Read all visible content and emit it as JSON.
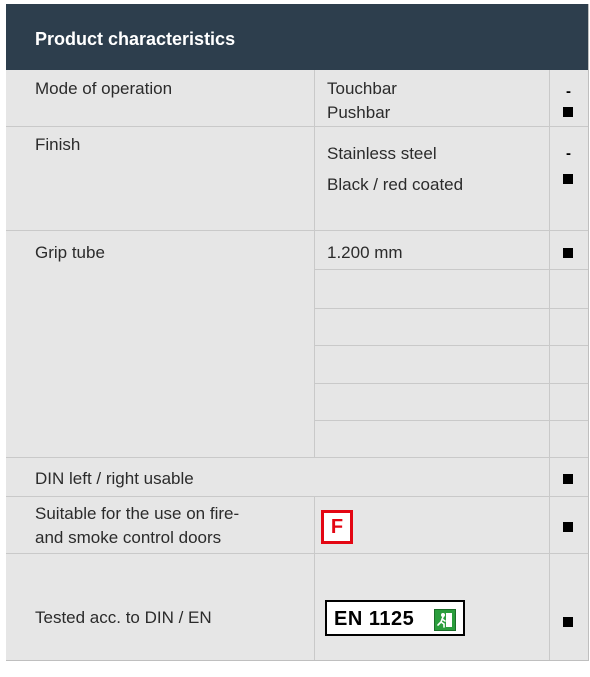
{
  "header": {
    "title": "Product characteristics"
  },
  "rows": {
    "mode": {
      "label": "Mode of operation",
      "value1": "Touchbar",
      "value2": "Pushbar",
      "mark1": "-",
      "mark2": "■"
    },
    "finish": {
      "label": "Finish",
      "value1": "Stainless steel",
      "value2": "Black / red coated",
      "mark1": "-",
      "mark2": "■"
    },
    "grip": {
      "label": "Grip tube",
      "value": "1.200 mm",
      "mark": "■"
    },
    "din": {
      "label": "DIN left / right usable",
      "mark": "■"
    },
    "fire": {
      "label_line1": "Suitable for the use on fire-",
      "label_line2": "and smoke control doors",
      "badge": "F",
      "mark": "■"
    },
    "tested": {
      "label": "Tested acc. to DIN / EN",
      "badge": "EN 1125",
      "mark": "■"
    }
  },
  "icons": {
    "fire_badge": "fire-door-icon",
    "exit_sign": "emergency-exit-icon",
    "check": "filled-square-icon"
  },
  "colors": {
    "header_bg": "#2d3e4d",
    "cell_bg": "#e6e6e6",
    "fire_red": "#e30613",
    "exit_green": "#2a9d3c"
  }
}
